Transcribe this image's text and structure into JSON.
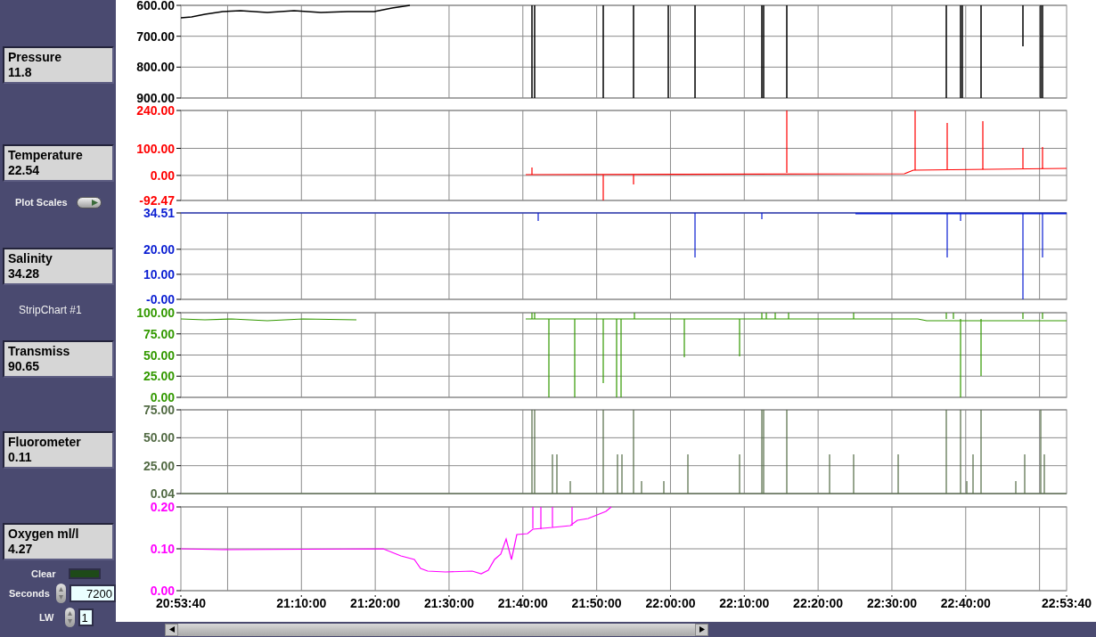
{
  "readouts": [
    {
      "label": "Pressure",
      "value": "11.8"
    },
    {
      "label": "Temperature",
      "value": "22.54"
    },
    {
      "label": "Salinity",
      "value": "34.28"
    },
    {
      "label": "Transmiss",
      "value": "90.65"
    },
    {
      "label": "Fluorometer",
      "value": "0.11"
    },
    {
      "label": "Oxygen ml/l",
      "value": "4.27"
    }
  ],
  "plot_scales": {
    "label": "Plot Scales"
  },
  "chart_title": "StripChart #1",
  "clear": {
    "label": "Clear",
    "on": false
  },
  "seconds": {
    "label": "Seconds",
    "value": "7200"
  },
  "lw": {
    "label": "LW",
    "value": "1"
  },
  "charts": [
    {
      "color": "#000000",
      "yticks": [
        "600.00",
        "700.00",
        "800.00",
        "900.00"
      ]
    },
    {
      "color": "#ff0000",
      "yticks": [
        "240.00",
        "100.00",
        "0.00",
        "-92.47"
      ]
    },
    {
      "color": "#0a1ed2",
      "yticks": [
        "34.51",
        "20.00",
        "10.00",
        "-0.00"
      ]
    },
    {
      "color": "#339900",
      "yticks": [
        "100.00",
        "75.00",
        "50.00",
        "25.00",
        "0.00"
      ]
    },
    {
      "color": "#536b45",
      "yticks": [
        "75.00",
        "50.00",
        "25.00",
        "0.04"
      ]
    },
    {
      "color": "#ff00ff",
      "yticks": [
        "0.20",
        "0.10",
        "0.00"
      ]
    }
  ],
  "time_axis": [
    "20:53:40",
    "21:10:00",
    "21:20:00",
    "21:30:00",
    "21:40:00",
    "21:50:00",
    "22:00:00",
    "22:10:00",
    "22:20:00",
    "22:30:00",
    "22:40:00",
    "22:53:40"
  ]
}
